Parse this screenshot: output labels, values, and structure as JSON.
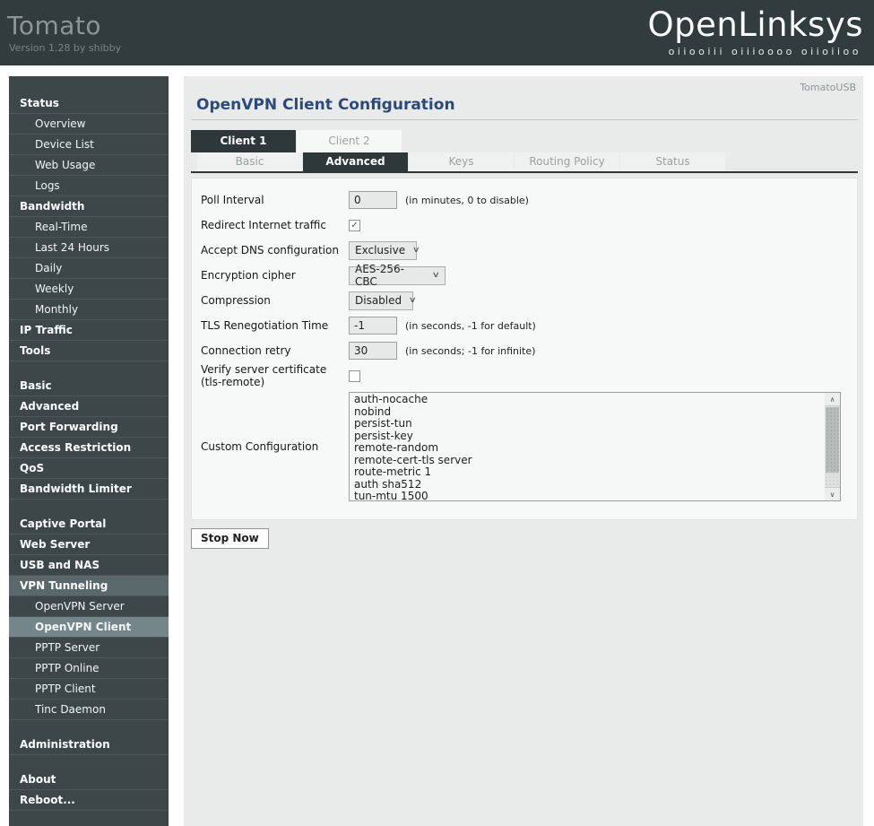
{
  "header": {
    "brand": "Tomato",
    "version": "Version 1.28 by shibby",
    "logo": "OpenLinksys",
    "logo_binary": "oiiooiii oiiioooo oiioiioo"
  },
  "corner_label": "TomatoUSB",
  "page_title": "OpenVPN Client Configuration",
  "tabs": {
    "clients": [
      {
        "label": "Client 1",
        "active": true
      },
      {
        "label": "Client 2",
        "active": false
      }
    ],
    "sections": [
      {
        "label": "Basic",
        "active": false
      },
      {
        "label": "Advanced",
        "active": true
      },
      {
        "label": "Keys",
        "active": false
      },
      {
        "label": "Routing Policy",
        "active": false
      },
      {
        "label": "Status",
        "active": false
      }
    ]
  },
  "sidebar": {
    "items": [
      {
        "label": "Status",
        "type": "hdr"
      },
      {
        "label": "Overview",
        "type": "sub"
      },
      {
        "label": "Device List",
        "type": "sub"
      },
      {
        "label": "Web Usage",
        "type": "sub"
      },
      {
        "label": "Logs",
        "type": "sub"
      },
      {
        "label": "Bandwidth",
        "type": "hdr"
      },
      {
        "label": "Real-Time",
        "type": "sub"
      },
      {
        "label": "Last 24 Hours",
        "type": "sub"
      },
      {
        "label": "Daily",
        "type": "sub"
      },
      {
        "label": "Weekly",
        "type": "sub"
      },
      {
        "label": "Monthly",
        "type": "sub"
      },
      {
        "label": "IP Traffic",
        "type": "hdr"
      },
      {
        "label": "Tools",
        "type": "hdr"
      },
      {
        "label": "",
        "type": "spacer"
      },
      {
        "label": "Basic",
        "type": "hdr"
      },
      {
        "label": "Advanced",
        "type": "hdr"
      },
      {
        "label": "Port Forwarding",
        "type": "hdr"
      },
      {
        "label": "Access Restriction",
        "type": "hdr"
      },
      {
        "label": "QoS",
        "type": "hdr"
      },
      {
        "label": "Bandwidth Limiter",
        "type": "hdr"
      },
      {
        "label": "",
        "type": "spacer"
      },
      {
        "label": "Captive Portal",
        "type": "hdr"
      },
      {
        "label": "Web Server",
        "type": "hdr"
      },
      {
        "label": "USB and NAS",
        "type": "hdr"
      },
      {
        "label": "VPN Tunneling",
        "type": "hdr",
        "highlight": "hl1"
      },
      {
        "label": "OpenVPN Server",
        "type": "sub"
      },
      {
        "label": "OpenVPN Client",
        "type": "sub",
        "highlight": "hl2"
      },
      {
        "label": "PPTP Server",
        "type": "sub"
      },
      {
        "label": "PPTP Online",
        "type": "sub"
      },
      {
        "label": "PPTP Client",
        "type": "sub"
      },
      {
        "label": "Tinc Daemon",
        "type": "sub"
      },
      {
        "label": "",
        "type": "spacer"
      },
      {
        "label": "Administration",
        "type": "hdr"
      },
      {
        "label": "",
        "type": "spacer"
      },
      {
        "label": "About",
        "type": "hdr"
      },
      {
        "label": "Reboot...",
        "type": "hdr"
      }
    ]
  },
  "form": {
    "poll_interval": {
      "label": "Poll Interval",
      "value": "0",
      "note": "(in minutes, 0 to disable)"
    },
    "redirect_traffic": {
      "label": "Redirect Internet traffic",
      "checked": true,
      "check_glyph": "✓"
    },
    "accept_dns": {
      "label": "Accept DNS configuration",
      "value": "Exclusive"
    },
    "cipher": {
      "label": "Encryption cipher",
      "value": "AES-256-CBC"
    },
    "compression": {
      "label": "Compression",
      "value": "Disabled"
    },
    "tls_renegotiation": {
      "label": "TLS Renegotiation Time",
      "value": "-1",
      "note": "(in seconds, -1 for default)"
    },
    "connection_retry": {
      "label": "Connection retry",
      "value": "30",
      "note": "(in seconds; -1 for infinite)"
    },
    "verify_cert": {
      "label": "Verify server certificate (tls-remote)",
      "checked": false
    },
    "custom_config": {
      "label": "Custom Configuration",
      "value": "auth-nocache\nnobind\npersist-tun\npersist-key\nremote-random\nremote-cert-tls server\nroute-metric 1\nauth sha512\ntun-mtu 1500"
    }
  },
  "buttons": {
    "stop": "Stop Now"
  },
  "colors": {
    "header_bg": "#323c3d",
    "sidebar_bg": "#3d4748",
    "sidebar_highlight": "#5a686b",
    "sidebar_active": "#75868b",
    "active_tab_bg": "#2e3838",
    "title_color": "#2b4a7b",
    "content_bg": "#e9ebeb",
    "panel_bg": "#f7f8f8"
  }
}
